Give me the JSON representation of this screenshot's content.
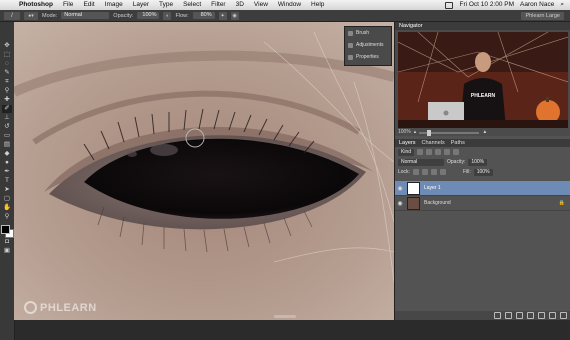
{
  "menubar": {
    "items": [
      "Photoshop",
      "File",
      "Edit",
      "Image",
      "Layer",
      "Type",
      "Select",
      "Filter",
      "3D",
      "View",
      "Window",
      "Help"
    ],
    "clock": "Fri Oct 10  2:00 PM",
    "user": "Aaron Nace"
  },
  "options": {
    "mode_label": "Mode:",
    "mode_value": "Normal",
    "opacity_label": "Opacity:",
    "opacity_value": "100%",
    "flow_label": "Flow:",
    "flow_value": "80%",
    "workspace": "Phlearn Large"
  },
  "mini_panel": {
    "items": [
      "Brush",
      "Adjustments",
      "Properties"
    ]
  },
  "navigator": {
    "title": "Navigator",
    "zoom": "100%",
    "thumb_text": "PHLEARN"
  },
  "layers": {
    "tabs": [
      "Layers",
      "Channels",
      "Paths"
    ],
    "filter": "Kind",
    "blend_mode": "Normal",
    "opacity_label": "Opacity:",
    "opacity_value": "100%",
    "lock_label": "Lock:",
    "fill_label": "Fill:",
    "fill_value": "100%",
    "items": [
      {
        "name": "Layer 1",
        "selected": true
      },
      {
        "name": "Background",
        "selected": false
      }
    ]
  },
  "watermark": "PHLEARN",
  "colors": {
    "selected_layer": "#6e8bb5",
    "foreground": "#000000",
    "background": "#ffffff"
  }
}
